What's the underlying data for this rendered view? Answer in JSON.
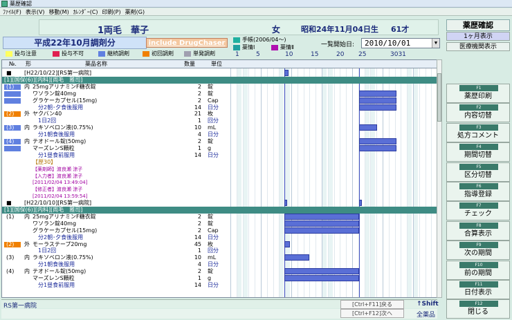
{
  "window": {
    "title": "薬歴確認"
  },
  "menu": [
    "ﾌｧｲﾙ(F)",
    "表示(V)",
    "移動(M)",
    "ｶﾚﾝﾀﾞｰ(C)",
    "印刷(P)",
    "薬剤(G)"
  ],
  "patient": {
    "name": "1両毛　華子",
    "sex": "女",
    "dob": "昭和24年11月04日生",
    "age": "61才"
  },
  "period_label": "平成22年10月調剤分",
  "drugchaser_button": "include DrugChaser",
  "legend": {
    "techo": "手帳(2006/04〜)",
    "info1": "薬情Ⅰ",
    "info2": "薬情Ⅱ",
    "caution": "投与注意",
    "forbid": "投与不可",
    "cont": "継続調剤",
    "first": "初回調剤",
    "single": "単発調剤"
  },
  "colors": {
    "caution": "#ffff60",
    "forbid": "#e02050",
    "cont": "#6080e0",
    "first": "#f08000",
    "single": "#a0a0b0",
    "techo": "#20b0a0",
    "info1": "#20a0a0",
    "info2": "#b010b0"
  },
  "start": {
    "label": "一覧開始日:",
    "value": "2010/10/01"
  },
  "calendar": {
    "days": [
      "1",
      "5",
      "10",
      "15",
      "20",
      "25",
      "3031"
    ]
  },
  "columns": {
    "no": "№.",
    "form": "形",
    "name": "薬品名称",
    "qty": "数量",
    "unit": "単位"
  },
  "rows": [
    {
      "a": "■",
      "b": "[H22/10/22][RS第一病院]",
      "style": ""
    },
    {
      "a": "[1][国保(6)][内科][両毛　雅司]",
      "style": "hl"
    },
    {
      "a": "(1)",
      "b": "内",
      "c": "25mgアリナミンF糖衣錠",
      "d": "2",
      "e": "錠",
      "style": "blue"
    },
    {
      "c": "ワソラン錠40mg",
      "d": "2",
      "e": "錠",
      "style": "blue"
    },
    {
      "c": "グラケーカプセル(15mg)",
      "d": "2",
      "e": "Cap",
      "style": "blue"
    },
    {
      "c": "分2朝･夕食後服用",
      "d": "14",
      "e": "日分",
      "style": "sub"
    },
    {
      "a": "(2)",
      "b": "外",
      "c": "ヤクバン40",
      "d": "21",
      "e": "枚",
      "style": "orange"
    },
    {
      "c": "1日2回",
      "d": "1",
      "e": "回分",
      "style": "sub"
    },
    {
      "a": "(3)",
      "b": "内",
      "c": "ラキソベロン液(0.75%)",
      "d": "10",
      "e": "mL",
      "style": "blue"
    },
    {
      "c": "分1朝食後服用",
      "d": "4",
      "e": "日分",
      "style": "sub"
    },
    {
      "a": "(4)",
      "b": "内",
      "c": "テオドール錠(50mg)",
      "d": "2",
      "e": "錠",
      "style": "blue"
    },
    {
      "c": "マーズレンS顆粒",
      "d": "1",
      "e": "g",
      "style": "blue"
    },
    {
      "c": "分1昼食前服用",
      "d": "14",
      "e": "日分",
      "style": "sub"
    },
    {
      "c": "【歴30】",
      "style": "note"
    },
    {
      "c": "【薬剤師】渡良瀬 涼子",
      "style": "note2"
    },
    {
      "c": "【入力者】渡良瀬 涼子",
      "style": "note2"
    },
    {
      "c": "[2011/02/04 13:49:04]",
      "style": "note2"
    },
    {
      "c": "【修正者】渡良瀬 涼子",
      "style": "note2"
    },
    {
      "c": "[2011/02/04 13:59:54]",
      "style": "note2"
    },
    {
      "a": "■",
      "b": "[H22/10/10][RS第一病院]",
      "style": ""
    },
    {
      "a": "[1][国保(6)][内科][両毛　雅司]",
      "style": "hl"
    },
    {
      "a": "(1)",
      "b": "内",
      "c": "25mgアリナミンF糖衣錠",
      "d": "2",
      "e": "錠",
      "style": ""
    },
    {
      "c": "ワソラン錠40mg",
      "d": "2",
      "e": "錠",
      "style": ""
    },
    {
      "c": "グラケーカプセル(15mg)",
      "d": "2",
      "e": "Cap",
      "style": ""
    },
    {
      "c": "分2朝･夕食後服用",
      "d": "14",
      "e": "日分",
      "style": "sub"
    },
    {
      "a": "(2)",
      "b": "外",
      "c": "モーラステープ20mg",
      "d": "45",
      "e": "枚",
      "style": "orange"
    },
    {
      "c": "1日2回",
      "d": "1",
      "e": "回分",
      "style": "sub"
    },
    {
      "a": "(3)",
      "b": "内",
      "c": "ラキソベロン液(0.75%)",
      "d": "10",
      "e": "mL",
      "style": ""
    },
    {
      "c": "分1朝食後服用",
      "d": "4",
      "e": "日分",
      "style": "sub"
    },
    {
      "a": "(4)",
      "b": "内",
      "c": "テオドール錠(50mg)",
      "d": "2",
      "e": "錠",
      "style": ""
    },
    {
      "c": "マーズレンS顆粒",
      "d": "1",
      "e": "g",
      "style": ""
    },
    {
      "c": "分1昼食前服用",
      "d": "14",
      "e": "日分",
      "style": "sub"
    }
  ],
  "status": {
    "hospital": "RS第一病院",
    "prev": "[Ctrl+F11]戻る",
    "next": "[Ctrl+F12]次へ",
    "shift": "↑Shift",
    "all": "全薬品"
  },
  "right": {
    "title": "薬歴確認",
    "month": "1ヶ月表示",
    "inst": "医療機関表示",
    "fkeys": [
      {
        "k": "F1",
        "t": "薬歴印刷"
      },
      {
        "k": "F2",
        "t": "内容切替"
      },
      {
        "k": "F3",
        "t": "処方コメント"
      },
      {
        "k": "F4",
        "t": "期間切替"
      },
      {
        "k": "F5",
        "t": "区分切替"
      },
      {
        "k": "F6",
        "t": "指導登録"
      },
      {
        "k": "F7",
        "t": "チェック"
      },
      {
        "k": "F8",
        "t": "合算表示"
      },
      {
        "k": "F9",
        "t": "次の期間"
      },
      {
        "k": "F10",
        "t": "前の期間"
      },
      {
        "k": "F11",
        "t": "日付表示"
      },
      {
        "k": "F12",
        "t": "閉じる"
      }
    ]
  }
}
